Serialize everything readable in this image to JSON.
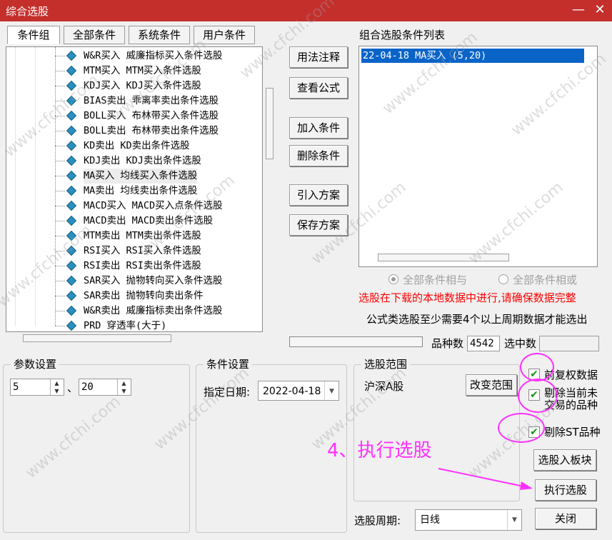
{
  "window": {
    "title": "综合选股",
    "minimize_symbol": "—",
    "close_symbol": "✕"
  },
  "tabs": [
    "条件组",
    "全部条件",
    "系统条件",
    "用户条件"
  ],
  "tree_items": [
    "W&R买入 威廉指标买入条件选股",
    "MTM买入 MTM买入条件选股",
    "KDJ买入 KDJ买入条件选股",
    "BIAS卖出 乖离率卖出条件选股",
    "BOLL买入 布林带买入条件选股",
    "BOLL卖出 布林带卖出条件选股",
    "KD卖出 KD卖出条件选股",
    "KDJ卖出 KDJ卖出条件选股",
    "MA买入 均线买入条件选股",
    "MA卖出 均线卖出条件选股",
    "MACD买入 MACD买入点条件选股",
    "MACD卖出 MACD卖出条件选股",
    "MTM卖出 MTM卖出条件选股",
    "RSI买入 RSI买入条件选股",
    "RSI卖出 RSI卖出条件选股",
    "SAR买入 抛物转向买入条件选股",
    "SAR卖出 抛物转向卖出条件",
    "W&R卖出 威廉指标卖出条件选股",
    "PRD 穿透率(大于)"
  ],
  "selected_tree_item": "MA买入 均线买入条件选股",
  "middle_buttons": {
    "usage_note": "用法注释",
    "view_formula": "查看公式",
    "add_condition": "加入条件",
    "delete_condition": "删除条件",
    "import_plan": "引入方案",
    "save_plan": "保存方案"
  },
  "condition_list": {
    "heading": "组合选股条件列表",
    "items": [
      "22-04-18 MA买入 (5,20)"
    ]
  },
  "logic": {
    "and_label": "全部条件相与",
    "or_label": "全部条件相或"
  },
  "notice": {
    "red": "选股在下载的本地数据中进行,请确保数据完整",
    "info": "公式类选股至少需要4个以上周期数据才能选出"
  },
  "counts": {
    "variety_label": "品种数",
    "variety_value": "4542",
    "selected_label": "选中数",
    "selected_value": ""
  },
  "params": {
    "heading": "参数设置",
    "p1": "5",
    "sep": "、",
    "p2": "20"
  },
  "condition_settings": {
    "heading": "条件设置",
    "date_label": "指定日期:",
    "date_value": "2022-04-18"
  },
  "range": {
    "heading": "选股范围",
    "market": "沪深A股",
    "change_button": "改变范围"
  },
  "options": {
    "forward_adjust": "前复权数据",
    "exclude_untradable": "剔除当前未交易的品种",
    "exclude_st": "剔除ST品种"
  },
  "actions": {
    "to_block": "选股入板块",
    "execute": "执行选股",
    "close": "关闭"
  },
  "period": {
    "label": "选股周期:",
    "value": "日线"
  },
  "annotation": {
    "text": "4、执行选股",
    "color": "#ff30ff"
  },
  "watermark_text": "www.cfchi.com"
}
